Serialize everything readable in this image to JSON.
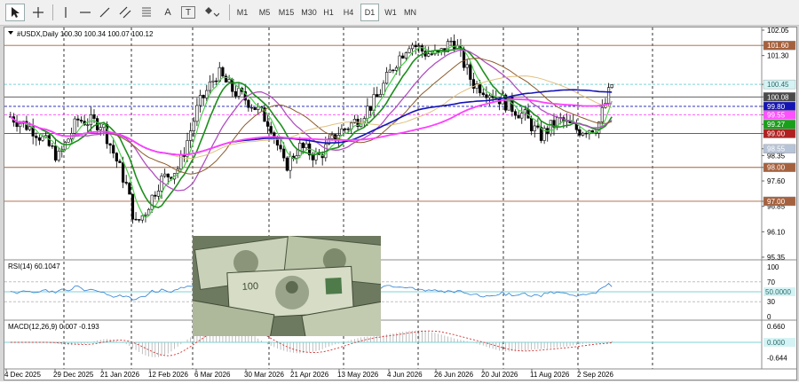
{
  "toolbar": {
    "tools": [
      {
        "name": "cursor-tool",
        "icon": "arrow-cursor-icon"
      },
      {
        "name": "crosshair-tool",
        "icon": "crosshair-icon"
      },
      {
        "name": "vertical-line-tool",
        "icon": "vertical-line-icon"
      },
      {
        "name": "horizontal-line-tool",
        "icon": "horizontal-line-icon"
      },
      {
        "name": "trendline-tool",
        "icon": "trendline-icon"
      },
      {
        "name": "equidistant-channel-tool",
        "icon": "channel-icon"
      },
      {
        "name": "fibonacci-tool",
        "icon": "fibonacci-icon"
      },
      {
        "name": "text-tool",
        "label": "A"
      },
      {
        "name": "text-label-tool",
        "label": "T"
      },
      {
        "name": "shapes-tool",
        "icon": "shapes-icon"
      }
    ],
    "timeframes": [
      "M1",
      "M5",
      "M15",
      "M30",
      "H1",
      "H4",
      "D1",
      "W1",
      "MN"
    ],
    "active_timeframe": "D1"
  },
  "main": {
    "header": "#USDX,Daily  100.30 100.34 100.07 100.12",
    "price_labels": [
      "102.05",
      "101.60",
      "101.30",
      "100.45",
      "100.08",
      "99.80",
      "99.55",
      "99.27",
      "99.00",
      "98.55",
      "98.35",
      "98.00",
      "97.60",
      "97.00",
      "96.85",
      "96.10",
      "95.35"
    ],
    "price_values": [
      102.05,
      101.6,
      101.3,
      100.45,
      100.08,
      99.8,
      99.55,
      99.27,
      99.0,
      98.55,
      98.35,
      98.0,
      97.6,
      97.0,
      96.85,
      96.1,
      95.35
    ],
    "price_tags": [
      {
        "label": "101.60",
        "bg": "#a5613e",
        "fg": "#ffffff"
      },
      {
        "label": "100.45",
        "bg": "#d5f3f4",
        "fg": "#2b6b6d"
      },
      {
        "label": "100.08",
        "bg": "#4a4a4a",
        "fg": "#ffffff"
      },
      {
        "label": "99.80",
        "bg": "#1414b4",
        "fg": "#ffffff"
      },
      {
        "label": "99.55",
        "bg": "#ff50ff",
        "fg": "#ffffff"
      },
      {
        "label": "99.27",
        "bg": "#18a018",
        "fg": "#ffffff"
      },
      {
        "label": "99.00",
        "bg": "#b02020",
        "fg": "#ffffff"
      },
      {
        "label": "98.55",
        "bg": "#b7c3d6",
        "fg": "#ffffff"
      },
      {
        "label": "98.00",
        "bg": "#a5613e",
        "fg": "#ffffff"
      },
      {
        "label": "97.00",
        "bg": "#a5613e",
        "fg": "#ffffff"
      }
    ],
    "level_colors": {
      "resistance": "#a5613e",
      "bid": "#4a4a4a",
      "ma_blue": "#1414b4",
      "ma_magenta": "#ff50ff",
      "ma_red": "#b02020",
      "ask": "#7dd3d6"
    }
  },
  "rsi": {
    "label": "RSI(14) 60.1047",
    "scale": [
      "100",
      "70",
      "50.0000",
      "30",
      "0"
    ],
    "line_color": "#2f7fd0",
    "level": 50
  },
  "macd": {
    "label": "MACD(12,26,9) 0.007 -0.193",
    "scale": [
      "0.660",
      "0.000",
      "-0.644"
    ]
  },
  "dates": [
    "4 Dec 2025",
    "29 Dec 2025",
    "21 Jan 2026",
    "12 Feb 2026",
    "6 Mar 2026",
    "30 Mar 2026",
    "21 Apr 2026",
    "13 May 2026",
    "4 Jun 2026",
    "26 Jun 2026",
    "20 Jul 2026",
    "11 Aug 2026",
    "2 Sep 2026"
  ]
}
